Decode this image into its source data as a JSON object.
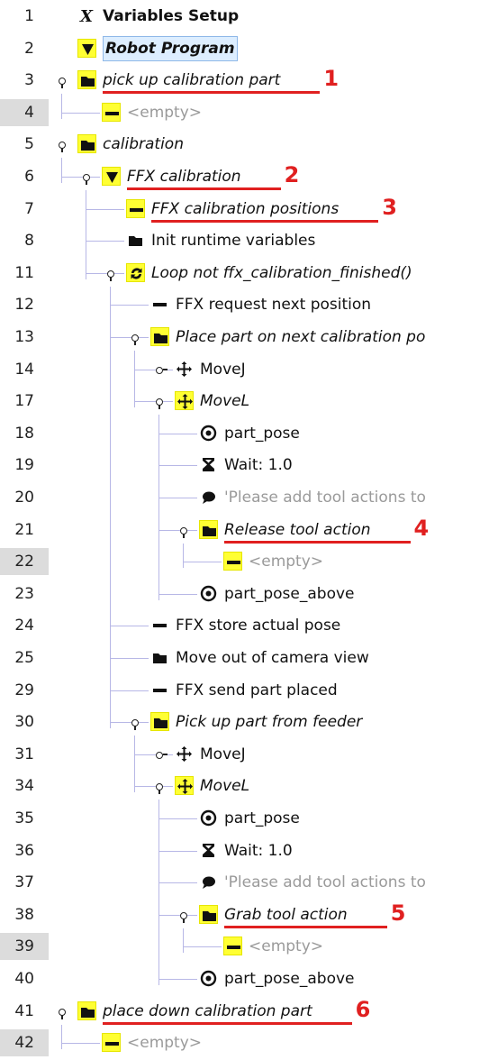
{
  "rows": [
    {
      "line": "1",
      "label": "Variables Setup",
      "icon": "variables-x-icon",
      "level": 0,
      "style": "bold"
    },
    {
      "line": "2",
      "label": "Robot Program",
      "icon": "triangle-down-icon",
      "level": 0,
      "style": "boxed",
      "yellow": true
    },
    {
      "line": "3",
      "label": "pick up calibration part",
      "icon": "folder-icon",
      "level": 0,
      "style": "italic",
      "yellow": true,
      "expander": true,
      "callout": "1"
    },
    {
      "line": "4",
      "label": "<empty>",
      "icon": "minus-icon",
      "level": 1,
      "style": "gray",
      "yellow": true,
      "selected": true
    },
    {
      "line": "5",
      "label": "calibration",
      "icon": "folder-icon",
      "level": 0,
      "style": "italic",
      "yellow": true,
      "expander": true
    },
    {
      "line": "6",
      "label": "FFX calibration",
      "icon": "triangle-down-icon",
      "level": 1,
      "style": "italic",
      "yellow": true,
      "expander": true,
      "callout": "2"
    },
    {
      "line": "7",
      "label": "FFX calibration positions",
      "icon": "minus-icon",
      "level": 2,
      "style": "italic",
      "yellow": true,
      "callout": "3"
    },
    {
      "line": "8",
      "label": "Init runtime variables",
      "icon": "folder-icon",
      "level": 2,
      "style": "normal"
    },
    {
      "line": "11",
      "label": "Loop not ffx_calibration_finished()",
      "icon": "loop-icon",
      "level": 2,
      "style": "italic",
      "yellow": true,
      "expander": true
    },
    {
      "line": "12",
      "label": "FFX request next position",
      "icon": "minus-icon",
      "level": 3,
      "style": "normal"
    },
    {
      "line": "13",
      "label": "Place part on next calibration po",
      "icon": "folder-icon",
      "level": 3,
      "style": "italic",
      "yellow": true,
      "expander": true
    },
    {
      "line": "14",
      "label": "MoveJ",
      "icon": "move-arrows-icon",
      "level": 4,
      "style": "normal",
      "expander": true,
      "collapsed": true
    },
    {
      "line": "17",
      "label": "MoveL",
      "icon": "move-arrows-icon",
      "level": 4,
      "style": "italic",
      "yellow": true,
      "expander": true
    },
    {
      "line": "18",
      "label": "part_pose",
      "icon": "waypoint-icon",
      "level": 5,
      "style": "normal"
    },
    {
      "line": "19",
      "label": "Wait: 1.0",
      "icon": "hourglass-icon",
      "level": 5,
      "style": "normal"
    },
    {
      "line": "20",
      "label": "'Please add tool actions to",
      "icon": "comment-icon",
      "level": 5,
      "style": "gray"
    },
    {
      "line": "21",
      "label": "Release tool action",
      "icon": "folder-icon",
      "level": 5,
      "style": "italic",
      "yellow": true,
      "expander": true,
      "callout": "4"
    },
    {
      "line": "22",
      "label": "<empty>",
      "icon": "minus-icon",
      "level": 6,
      "style": "gray",
      "yellow": true,
      "selected": true
    },
    {
      "line": "23",
      "label": "part_pose_above",
      "icon": "waypoint-icon",
      "level": 5,
      "style": "normal"
    },
    {
      "line": "24",
      "label": "FFX store actual pose",
      "icon": "minus-icon",
      "level": 3,
      "style": "normal"
    },
    {
      "line": "25",
      "label": "Move out of camera view",
      "icon": "folder-icon",
      "level": 3,
      "style": "normal"
    },
    {
      "line": "29",
      "label": "FFX send part placed",
      "icon": "minus-icon",
      "level": 3,
      "style": "normal"
    },
    {
      "line": "30",
      "label": "Pick up part from feeder",
      "icon": "folder-icon",
      "level": 3,
      "style": "italic",
      "yellow": true,
      "expander": true
    },
    {
      "line": "31",
      "label": "MoveJ",
      "icon": "move-arrows-icon",
      "level": 4,
      "style": "normal",
      "expander": true,
      "collapsed": true
    },
    {
      "line": "34",
      "label": "MoveL",
      "icon": "move-arrows-icon",
      "level": 4,
      "style": "italic",
      "yellow": true,
      "expander": true
    },
    {
      "line": "35",
      "label": "part_pose",
      "icon": "waypoint-icon",
      "level": 5,
      "style": "normal"
    },
    {
      "line": "36",
      "label": "Wait: 1.0",
      "icon": "hourglass-icon",
      "level": 5,
      "style": "normal"
    },
    {
      "line": "37",
      "label": "'Please add tool actions to",
      "icon": "comment-icon",
      "level": 5,
      "style": "gray"
    },
    {
      "line": "38",
      "label": "Grab tool action",
      "icon": "folder-icon",
      "level": 5,
      "style": "italic",
      "yellow": true,
      "expander": true,
      "callout": "5"
    },
    {
      "line": "39",
      "label": "<empty>",
      "icon": "minus-icon",
      "level": 6,
      "style": "gray",
      "yellow": true,
      "selected": true
    },
    {
      "line": "40",
      "label": "part_pose_above",
      "icon": "waypoint-icon",
      "level": 5,
      "style": "normal"
    },
    {
      "line": "41",
      "label": "place down calibration part",
      "icon": "folder-icon",
      "level": 0,
      "style": "italic",
      "yellow": true,
      "expander": true,
      "callout": "6"
    },
    {
      "line": "42",
      "label": "<empty>",
      "icon": "minus-icon",
      "level": 1,
      "style": "gray",
      "yellow": true,
      "selected": true
    }
  ],
  "colors": {
    "highlight_yellow": "#ffff33",
    "callout_red": "#e02020",
    "tree_line": "#b7b7e6",
    "selected_gutter": "#dcdcdc",
    "program_box": "#ddeeff"
  }
}
